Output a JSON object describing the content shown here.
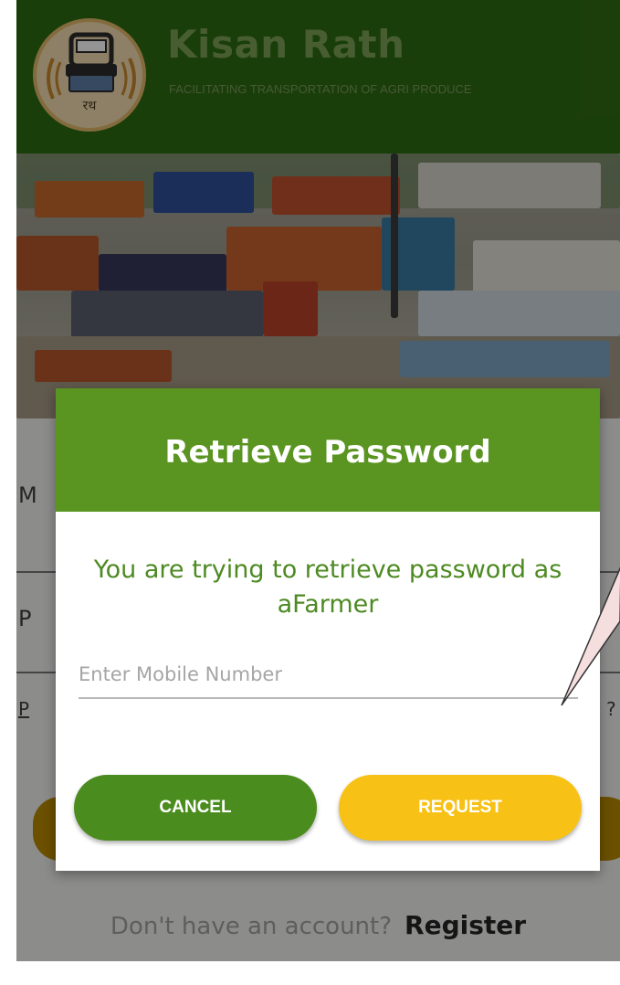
{
  "header": {
    "app_name": "Kisan Rath",
    "tagline": "FACILITATING TRANSPORTATION OF AGRI PRODUCE",
    "logo_text": "रथ"
  },
  "background_form": {
    "field1_letter": "M",
    "field2_letter": "P",
    "link_letter": "P",
    "link_suffix": "?"
  },
  "dialog": {
    "title": "Retrieve Password",
    "message": "You are trying to retrieve password as aFarmer",
    "mobile_placeholder": "Enter Mobile Number",
    "mobile_value": "",
    "cancel_label": "CANCEL",
    "request_label": "REQUEST"
  },
  "footer": {
    "prompt": "Don't have an account?",
    "register_label": "Register"
  },
  "colors": {
    "header_green": "#2e6b12",
    "dialog_header_green": "#5a9421",
    "cancel_green": "#4a8c1d",
    "request_yellow": "#f8c115",
    "message_green": "#4d8a22"
  }
}
